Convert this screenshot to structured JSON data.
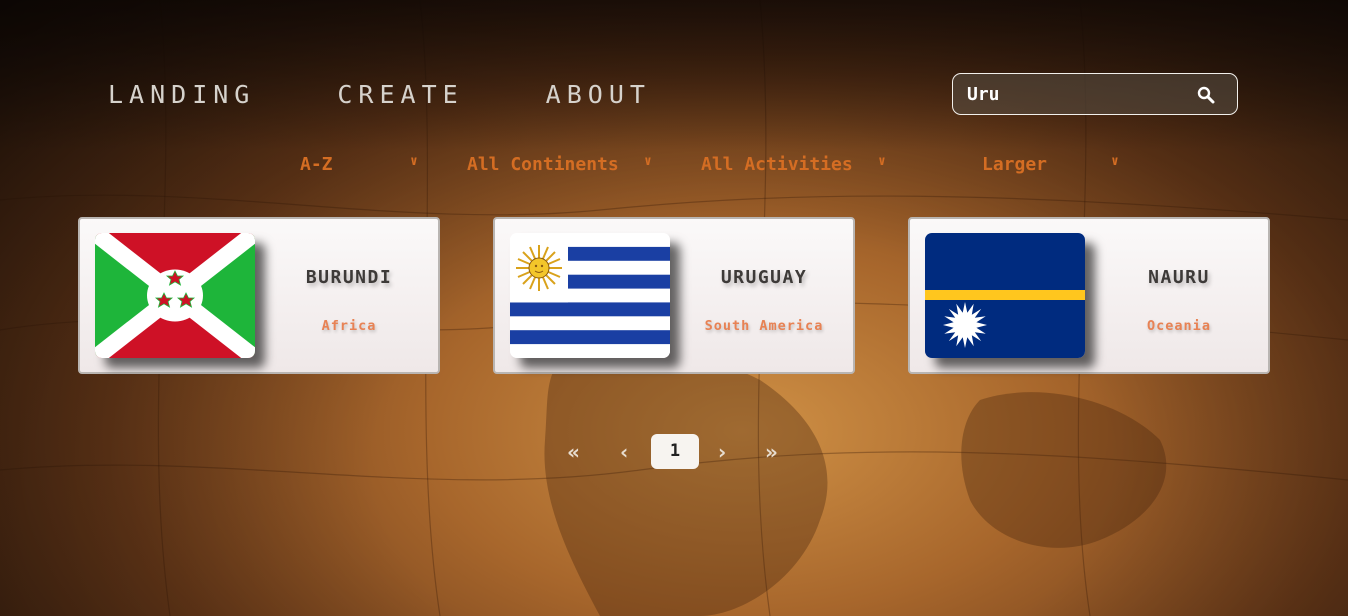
{
  "nav": {
    "items": [
      {
        "label": "LANDING"
      },
      {
        "label": "CREATE"
      },
      {
        "label": "ABOUT"
      }
    ]
  },
  "search": {
    "value": "Uru",
    "icon": "search-icon"
  },
  "filters": {
    "order": "A-Z",
    "continent": "All Continents",
    "activity": "All Activities",
    "population": "Larger"
  },
  "cards": [
    {
      "name": "BURUNDI",
      "continent": "Africa",
      "flag": "burundi-flag"
    },
    {
      "name": "URUGUAY",
      "continent": "South America",
      "flag": "uruguay-flag"
    },
    {
      "name": "NAURU",
      "continent": "Oceania",
      "flag": "nauru-flag"
    }
  ],
  "pagination": {
    "first": "«",
    "prev": "‹",
    "current": "1",
    "next": "›",
    "last": "»"
  },
  "colors": {
    "accent": "#d46d23",
    "continent_text": "#e88254",
    "nav_text": "#d6d2cc"
  }
}
